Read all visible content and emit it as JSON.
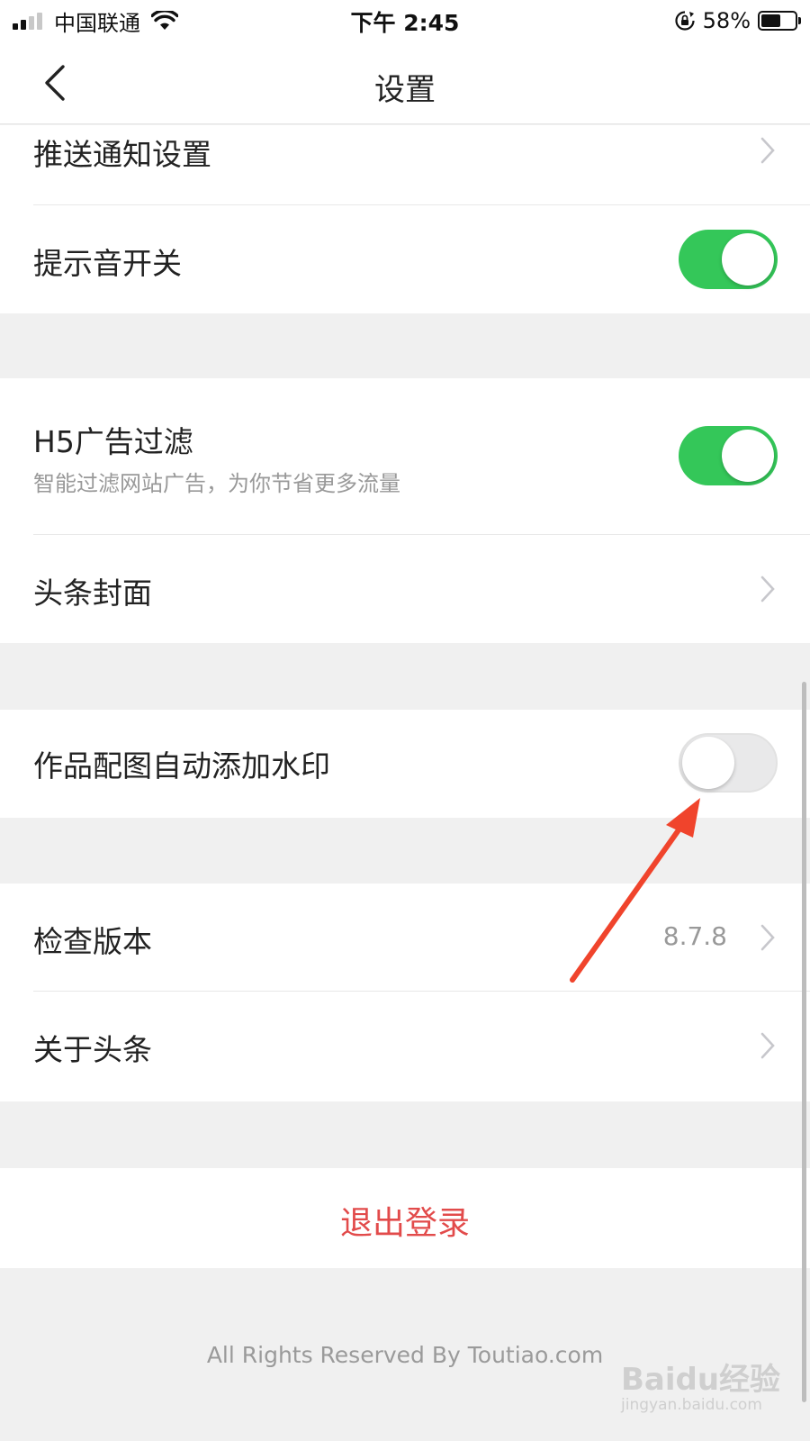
{
  "status_bar": {
    "carrier": "中国联通",
    "time": "下午 2:45",
    "battery_percent": "58%",
    "battery_level": 0.58
  },
  "nav": {
    "title": "设置",
    "back_icon": "chevron-left-icon"
  },
  "settings": {
    "push": {
      "label": "推送通知设置"
    },
    "sound": {
      "label": "提示音开关",
      "enabled": true
    },
    "ad_filter": {
      "label": "H5广告过滤",
      "subtitle": "智能过滤网站广告，为你节省更多流量",
      "enabled": true
    },
    "cover": {
      "label": "头条封面"
    },
    "watermark": {
      "label": "作品配图自动添加水印",
      "enabled": false
    },
    "version": {
      "label": "检查版本",
      "value": "8.7.8"
    },
    "about": {
      "label": "关于头条"
    }
  },
  "logout": {
    "label": "退出登录"
  },
  "footer": {
    "text": "All Rights Reserved By Toutiao.com"
  },
  "watermark_overlay": {
    "brand": "Baidu经验",
    "url": "jingyan.baidu.com"
  },
  "colors": {
    "toggle_on": "#34c759",
    "toggle_off": "#e9e9ea",
    "logout_text": "#e24b4b",
    "annotation_arrow": "#f0442c"
  }
}
